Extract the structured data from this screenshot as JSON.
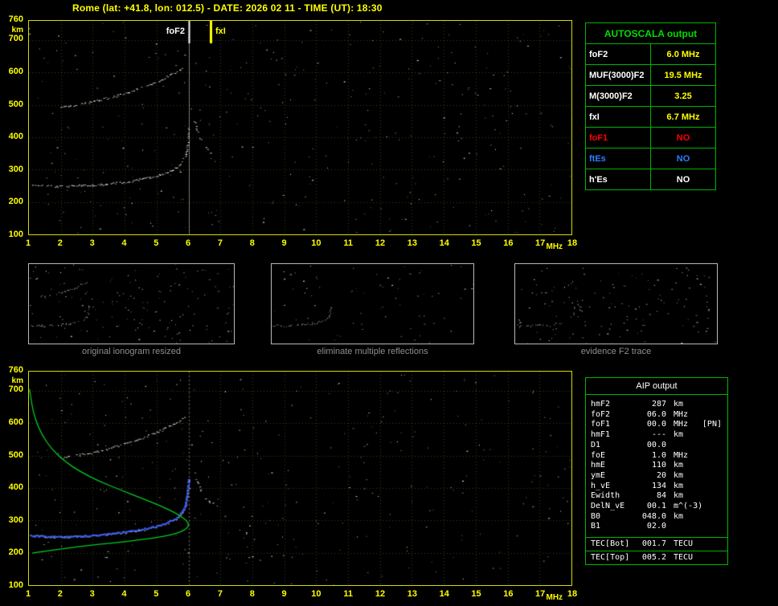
{
  "header": {
    "title": "Rome (lat: +41.8, lon: 012.5) - DATE: 2026 02 11 - TIME (UT): 18:30"
  },
  "colors": {
    "background": "#000000",
    "axis_yellow": "#ffff00",
    "frame_yellow": "#d8d800",
    "table_green": "#00b400",
    "header_green": "#00dc00",
    "red": "#ff0000",
    "blue": "#2a7fff",
    "white": "#ffffff",
    "profile_green": "#00cc22",
    "fit_blue": "#3c5fff",
    "caption_gray": "#8f8f8f"
  },
  "autoscala": {
    "title": "AUTOSCALA output",
    "rows": [
      {
        "param": "foF2",
        "value": "6.0 MHz",
        "label_color": "#ffffff",
        "value_color": "#ffff00"
      },
      {
        "param": "MUF(3000)F2",
        "value": "19.5 MHz",
        "label_color": "#ffffff",
        "value_color": "#ffff00"
      },
      {
        "param": "M(3000)F2",
        "value": "3.25",
        "label_color": "#ffffff",
        "value_color": "#ffff00"
      },
      {
        "param": "fxI",
        "value": "6.7 MHz",
        "label_color": "#ffffff",
        "value_color": "#ffff00"
      },
      {
        "param": "foF1",
        "value": "NO",
        "label_color": "#ff0000",
        "value_color": "#ff0000"
      },
      {
        "param": "ftEs",
        "value": "NO",
        "label_color": "#2a7fff",
        "value_color": "#2a7fff"
      },
      {
        "param": "h'Es",
        "value": "NO",
        "label_color": "#ffffff",
        "value_color": "#ffffff"
      }
    ]
  },
  "thumbnails": [
    {
      "caption": "original ionogram resized"
    },
    {
      "caption": "eliminate multiple reflections"
    },
    {
      "caption": "evidence F2 trace"
    }
  ],
  "aip": {
    "title": "AIP output",
    "rows": [
      {
        "param": "hmF2",
        "value": "287",
        "unit": "km",
        "note": ""
      },
      {
        "param": "foF2",
        "value": "06.0",
        "unit": "MHz",
        "note": ""
      },
      {
        "param": "foF1",
        "value": "00.0",
        "unit": "MHz",
        "note": "[PN]"
      },
      {
        "param": "hmF1",
        "value": "---",
        "unit": "km",
        "note": ""
      },
      {
        "param": "D1",
        "value": "00.0",
        "unit": "",
        "note": ""
      },
      {
        "param": "foE",
        "value": "1.0",
        "unit": "MHz",
        "note": ""
      },
      {
        "param": "hmE",
        "value": "110",
        "unit": "km",
        "note": ""
      },
      {
        "param": "ymE",
        "value": "20",
        "unit": "km",
        "note": ""
      },
      {
        "param": "h_vE",
        "value": "134",
        "unit": "km",
        "note": ""
      },
      {
        "param": "Ewidth",
        "value": "84",
        "unit": "km",
        "note": ""
      },
      {
        "param": "DelN_vE",
        "value": "00.1",
        "unit": "m^(-3)",
        "note": ""
      },
      {
        "param": "B0",
        "value": "048.0",
        "unit": "km",
        "note": ""
      },
      {
        "param": "B1",
        "value": "02.0",
        "unit": "",
        "note": ""
      }
    ],
    "tec_rows": [
      {
        "param": "TEC[Bot]",
        "value": "001.7",
        "unit": "TECU"
      },
      {
        "param": "TEC[Top]",
        "value": "005.2",
        "unit": "TECU"
      }
    ]
  },
  "chart_data": [
    {
      "id": "main_ionogram",
      "type": "scatter",
      "title": "",
      "xlabel": "MHz",
      "ylabel": "km",
      "xlim": [
        1,
        18
      ],
      "ylim": [
        100,
        760
      ],
      "x_ticks": [
        1,
        2,
        3,
        4,
        5,
        6,
        7,
        8,
        9,
        10,
        11,
        12,
        13,
        14,
        15,
        16,
        17,
        18
      ],
      "y_ticks": [
        760,
        700,
        600,
        500,
        400,
        300,
        200,
        100
      ],
      "grid": true,
      "annotations": [
        {
          "label": "foF2",
          "x": 6.0,
          "color": "#ffffff"
        },
        {
          "label": "fxI",
          "x": 6.7,
          "color": "#ffff00"
        }
      ],
      "series": [
        {
          "name": "F2-ordinary-trace",
          "color": "#ffffff",
          "points": [
            [
              1.1,
              253
            ],
            [
              1.6,
              250
            ],
            [
              2.1,
              249
            ],
            [
              2.6,
              251
            ],
            [
              3.1,
              254
            ],
            [
              3.6,
              258
            ],
            [
              4.1,
              264
            ],
            [
              4.6,
              272
            ],
            [
              5.0,
              281
            ],
            [
              5.3,
              291
            ],
            [
              5.6,
              306
            ],
            [
              5.8,
              324
            ],
            [
              5.9,
              346
            ],
            [
              5.96,
              378
            ],
            [
              6.0,
              432
            ]
          ]
        },
        {
          "name": "F2-second-hop-trace",
          "color": "#ffffff",
          "points": [
            [
              1.95,
              492
            ],
            [
              2.3,
              498
            ],
            [
              2.7,
              505
            ],
            [
              3.1,
              513
            ],
            [
              3.5,
              523
            ],
            [
              3.9,
              534
            ],
            [
              4.3,
              547
            ],
            [
              4.7,
              561
            ],
            [
              5.1,
              577
            ],
            [
              5.45,
              594
            ],
            [
              5.7,
              608
            ],
            [
              5.9,
              624
            ]
          ]
        },
        {
          "name": "F2-extraordinary-trace",
          "color": "#ffffff",
          "points": [
            [
              6.18,
              452
            ],
            [
              6.28,
              412
            ],
            [
              6.4,
              388
            ],
            [
              6.52,
              370
            ],
            [
              6.62,
              358
            ],
            [
              6.7,
              350
            ]
          ]
        }
      ]
    },
    {
      "id": "profile_ionogram",
      "type": "scatter",
      "title": "",
      "xlabel": "MHz",
      "ylabel": "km",
      "xlim": [
        1,
        18
      ],
      "ylim": [
        100,
        760
      ],
      "x_ticks": [
        1,
        2,
        3,
        4,
        5,
        6,
        7,
        8,
        9,
        10,
        11,
        12,
        13,
        14,
        15,
        16,
        17,
        18
      ],
      "y_ticks": [
        760,
        700,
        600,
        500,
        400,
        300,
        200,
        100
      ],
      "grid": true,
      "annotations": [
        {
          "label": "",
          "x": 6.0,
          "color": "#ffffff"
        }
      ],
      "series": [
        {
          "name": "F2-ordinary-trace",
          "color": "#ffffff",
          "points": [
            [
              1.1,
              253
            ],
            [
              1.6,
              250
            ],
            [
              2.1,
              249
            ],
            [
              2.6,
              251
            ],
            [
              3.1,
              254
            ],
            [
              3.6,
              258
            ],
            [
              4.1,
              264
            ],
            [
              4.6,
              272
            ],
            [
              5.0,
              281
            ],
            [
              5.3,
              291
            ],
            [
              5.6,
              306
            ],
            [
              5.8,
              324
            ],
            [
              5.9,
              346
            ],
            [
              5.96,
              378
            ],
            [
              6.0,
              432
            ]
          ]
        },
        {
          "name": "F2-second-hop-trace",
          "color": "#ffffff",
          "points": [
            [
              1.95,
              492
            ],
            [
              2.3,
              498
            ],
            [
              2.7,
              505
            ],
            [
              3.1,
              513
            ],
            [
              3.5,
              523
            ],
            [
              3.9,
              534
            ],
            [
              4.3,
              547
            ],
            [
              4.7,
              561
            ],
            [
              5.1,
              577
            ],
            [
              5.45,
              594
            ],
            [
              5.7,
              608
            ],
            [
              5.9,
              624
            ]
          ]
        },
        {
          "name": "F2-extraordinary-trace",
          "color": "#ffffff",
          "points": [
            [
              6.18,
              452
            ],
            [
              6.28,
              412
            ],
            [
              6.4,
              388
            ],
            [
              6.52,
              370
            ],
            [
              6.62,
              358
            ],
            [
              6.7,
              350
            ]
          ]
        }
      ],
      "profile": {
        "name": "electron-density-profile",
        "color": "#00cc22",
        "points": [
          [
            1.02,
            706
          ],
          [
            1.08,
            662
          ],
          [
            1.2,
            612
          ],
          [
            1.4,
            565
          ],
          [
            1.7,
            522
          ],
          [
            2.1,
            484
          ],
          [
            2.6,
            451
          ],
          [
            3.2,
            421
          ],
          [
            3.9,
            393
          ],
          [
            4.6,
            366
          ],
          [
            5.2,
            342
          ],
          [
            5.65,
            320
          ],
          [
            5.92,
            302
          ],
          [
            6.02,
            287
          ],
          [
            5.92,
            272
          ],
          [
            5.6,
            259
          ],
          [
            5.1,
            248
          ],
          [
            4.4,
            239
          ],
          [
            3.6,
            230
          ],
          [
            2.8,
            222
          ],
          [
            2.1,
            213
          ],
          [
            1.5,
            205
          ],
          [
            1.1,
            199
          ]
        ]
      },
      "fit": {
        "name": "autoscala-restored-trace",
        "color": "#3c5fff",
        "points": [
          [
            1.05,
            252
          ],
          [
            1.5,
            250
          ],
          [
            2.0,
            248
          ],
          [
            2.5,
            250
          ],
          [
            3.0,
            253
          ],
          [
            3.5,
            257
          ],
          [
            4.0,
            263
          ],
          [
            4.5,
            271
          ],
          [
            5.0,
            281
          ],
          [
            5.3,
            291
          ],
          [
            5.6,
            306
          ],
          [
            5.8,
            325
          ],
          [
            5.9,
            347
          ],
          [
            5.96,
            382
          ],
          [
            6.02,
            434
          ]
        ]
      }
    }
  ]
}
